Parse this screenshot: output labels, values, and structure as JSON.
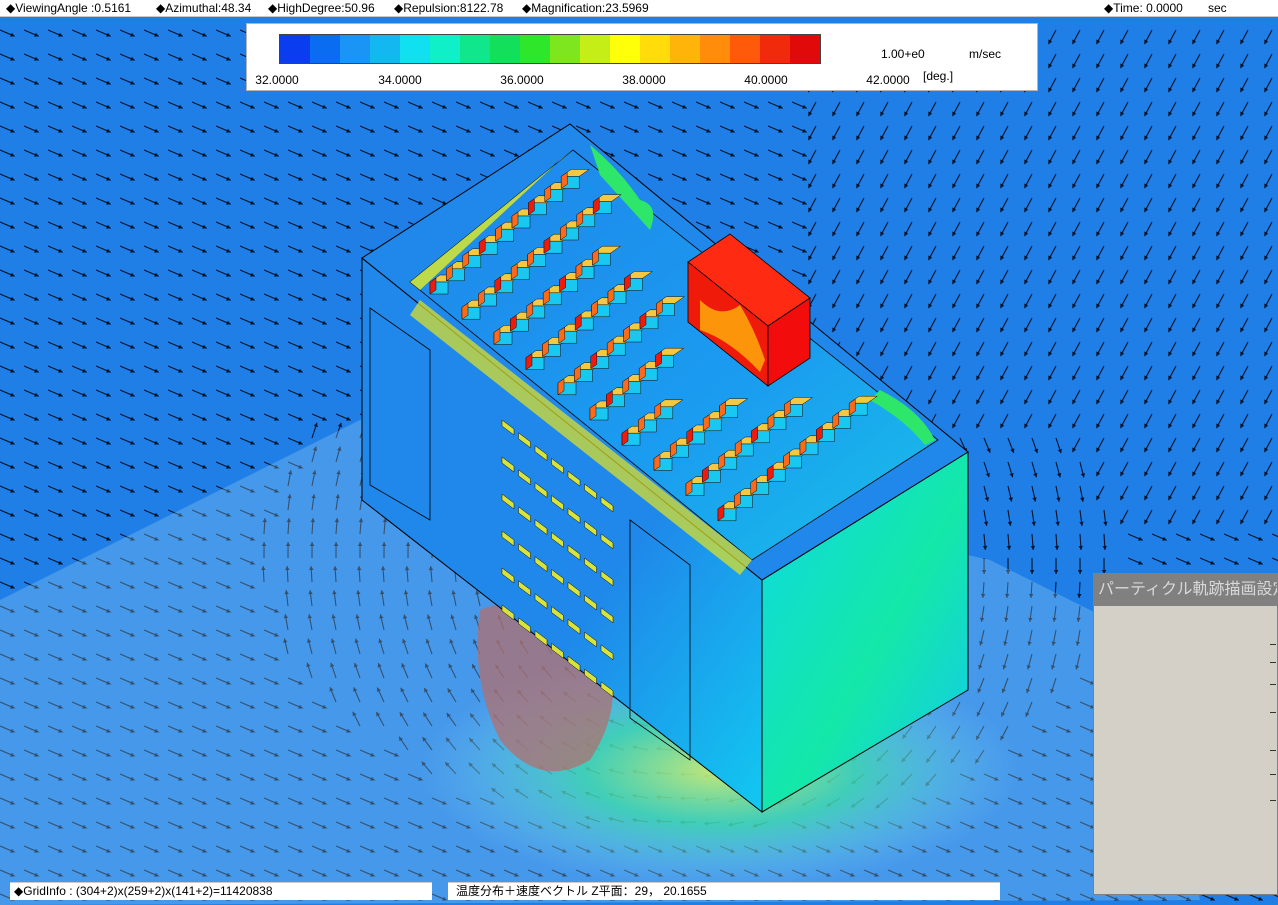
{
  "header": {
    "viewing_angle": "◆ViewingAngle :0.5161",
    "azimuthal": "◆Azimuthal:48.34",
    "high_degree": "◆HighDegree:50.96",
    "repulsion": "◆Repulsion:8122.78",
    "magnification": "◆Magnification:23.5969",
    "time": "◆Time: 0.0000",
    "time_unit": "sec"
  },
  "legend": {
    "colors": [
      "#0a3cf0",
      "#0a6cf0",
      "#1a94f5",
      "#14b8f0",
      "#10e0f0",
      "#10f0c8",
      "#10e68c",
      "#12e05a",
      "#2ee62a",
      "#7ee61e",
      "#c4ee16",
      "#ffff0a",
      "#ffdc0a",
      "#ffb40a",
      "#ff8c0a",
      "#ff5a0a",
      "#f02a0a",
      "#e00a0a"
    ],
    "ticks": [
      "32.0000",
      "34.0000",
      "36.0000",
      "38.0000",
      "40.0000",
      "42.0000"
    ],
    "vector_scale": "1.00+e0",
    "velocity_unit": "m/sec",
    "temp_unit": "[deg.]"
  },
  "scene": {
    "background_color": "#1f7fe6",
    "box_face_color": "#1f88ea",
    "hot_color": "#e80a0a"
  },
  "status": {
    "grid_info": "◆GridInfo : (304+2)x(259+2)x(141+2)=11420838",
    "plane_info": "温度分布＋速度ベクトル Z平面：29， 20.1655"
  },
  "dialog": {
    "title": "パーティクル軌跡描画設定ダ"
  }
}
